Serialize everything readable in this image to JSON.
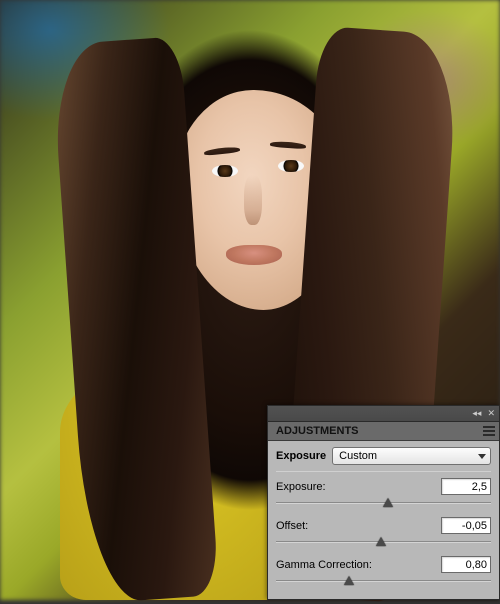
{
  "panel": {
    "title": "ADJUSTMENTS",
    "adjustment_name": "Exposure",
    "preset_value": "Custom",
    "sliders": {
      "exposure": {
        "label": "Exposure:",
        "value": "2,5",
        "thumb_pct": 52
      },
      "offset": {
        "label": "Offset:",
        "value": "-0,05",
        "thumb_pct": 49
      },
      "gamma": {
        "label": "Gamma Correction:",
        "value": "0,80",
        "thumb_pct": 34
      }
    }
  }
}
